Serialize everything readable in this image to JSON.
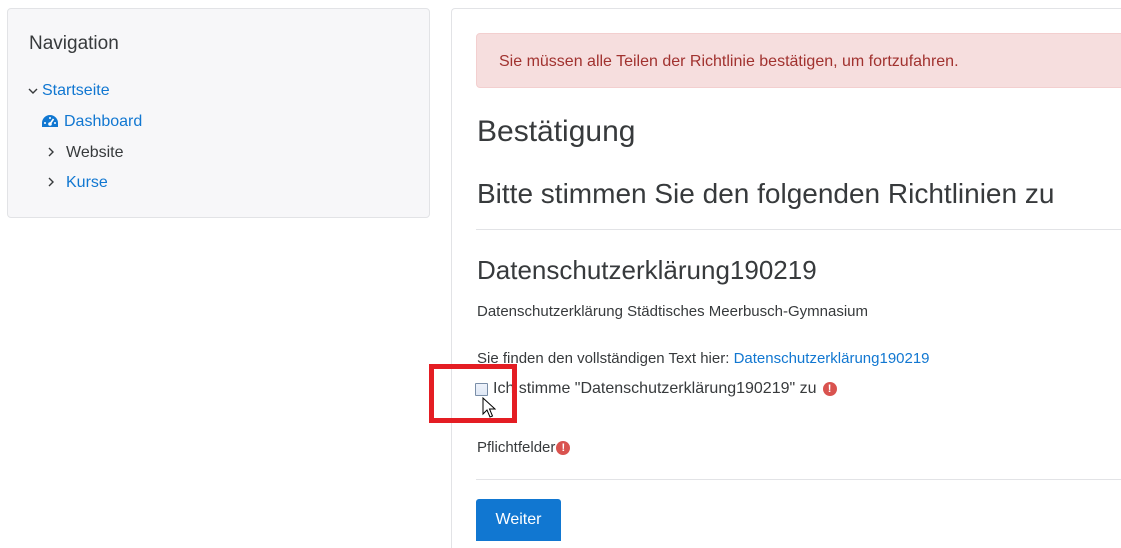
{
  "navigation": {
    "title": "Navigation",
    "items": [
      {
        "label": "Startseite",
        "icon": "chevron-down-icon"
      },
      {
        "label": "Dashboard",
        "icon": "dashboard-icon"
      },
      {
        "label": "Website",
        "icon": "chevron-right-icon"
      },
      {
        "label": "Kurse",
        "icon": "chevron-right-icon"
      }
    ]
  },
  "alert": {
    "text": "Sie müssen alle Teilen der Richtlinie bestätigen, um fortzufahren."
  },
  "main": {
    "heading": "Bestätigung",
    "subheading": "Bitte stimmen Sie den folgenden Richtlinien zu",
    "policy": {
      "title": "Datenschutzerklärung190219",
      "summary": "Datenschutzerklärung Städtisches Meerbusch-Gymnasium",
      "full_text_prefix": "Sie finden den vollständigen Text hier: ",
      "full_text_link": "Datenschutzerklärung190219",
      "agree_label": "Ich stimme \"Datenschutzerklärung190219\" zu"
    },
    "required_label": "Pflichtfelder",
    "submit_label": "Weiter"
  },
  "colors": {
    "link": "#1177d1",
    "alert_bg": "#f6dede",
    "alert_text": "#a1322f",
    "required_icon": "#d9534f",
    "highlight_box": "#e41d23"
  }
}
